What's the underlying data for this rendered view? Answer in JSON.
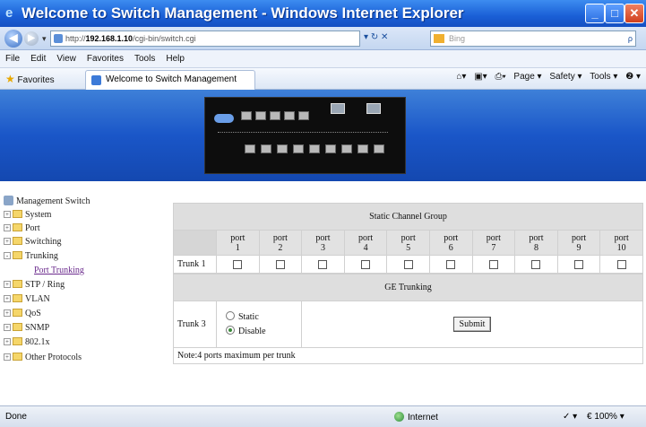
{
  "window": {
    "title": "Welcome to Switch Management - Windows Internet Explorer",
    "minimize": "_",
    "maximize": "□",
    "close": "✕"
  },
  "address_bar": {
    "url_prefix": "http://",
    "url_host": "192.168.1.10",
    "url_path": "/cgi-bin/switch.cgi",
    "refresh": "↻",
    "stop": "✕",
    "search_placeholder": "Bing",
    "search_go": "ρ"
  },
  "menu": [
    "File",
    "Edit",
    "View",
    "Favorites",
    "Tools",
    "Help"
  ],
  "favorites_bar": {
    "favorites_label": "Favorites",
    "tab_title": "Welcome to Switch Management",
    "commands": [
      "Page ▾",
      "Safety ▾",
      "Tools ▾",
      "❷ ▾"
    ]
  },
  "sidebar": {
    "root": "Management Switch",
    "items": [
      {
        "label": "System",
        "expander": "+"
      },
      {
        "label": "Port",
        "expander": "+"
      },
      {
        "label": "Switching",
        "expander": "+"
      },
      {
        "label": "Trunking",
        "expander": "-"
      },
      {
        "label": "Port Trunking",
        "link": true
      },
      {
        "label": "STP / Ring",
        "expander": "+"
      },
      {
        "label": "VLAN",
        "expander": "+"
      },
      {
        "label": "QoS",
        "expander": "+"
      },
      {
        "label": "SNMP",
        "expander": "+"
      },
      {
        "label": "802.1x",
        "expander": "+"
      },
      {
        "label": "Other Protocols",
        "expander": "+"
      }
    ]
  },
  "static_group": {
    "title": "Static Channel Group",
    "ports": [
      {
        "top": "port",
        "num": "1"
      },
      {
        "top": "port",
        "num": "2"
      },
      {
        "top": "port",
        "num": "3"
      },
      {
        "top": "port",
        "num": "4"
      },
      {
        "top": "port",
        "num": "5"
      },
      {
        "top": "port",
        "num": "6"
      },
      {
        "top": "port",
        "num": "7"
      },
      {
        "top": "port",
        "num": "8"
      },
      {
        "top": "port",
        "num": "9"
      },
      {
        "top": "port",
        "num": "10"
      }
    ],
    "trunk_label": "Trunk 1"
  },
  "ge_trunking": {
    "title": "GE Trunking",
    "trunk_label": "Trunk 3",
    "options": [
      "Static",
      "Disable"
    ],
    "selected": "Disable",
    "submit": "Submit"
  },
  "note": "Note:4 ports maximum per trunk",
  "status": {
    "left": "Done",
    "zone": "Internet",
    "protected": "✓ ▾",
    "zoom": "€ 100% ▾"
  }
}
